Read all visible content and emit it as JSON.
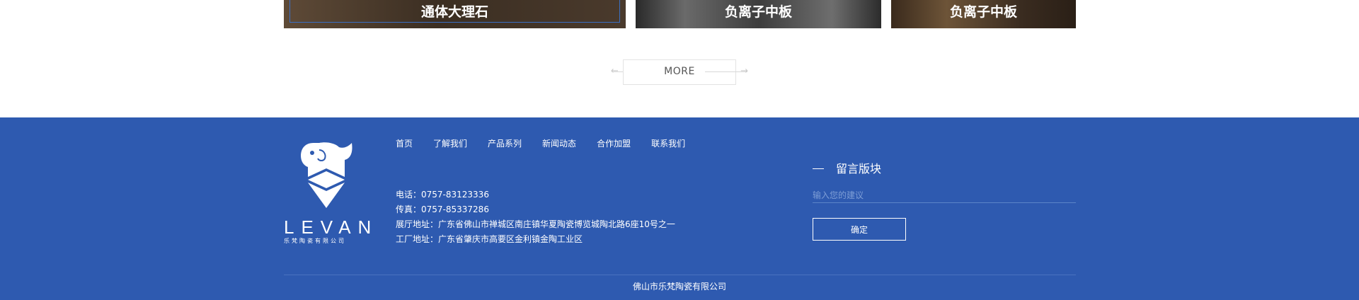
{
  "products": [
    {
      "label": "通体大理石"
    },
    {
      "label": "负离子中板"
    },
    {
      "label": "负离子中板"
    }
  ],
  "more": {
    "label": "MORE",
    "left_icon": "arrow-left-icon",
    "right_icon": "arrow-right-icon"
  },
  "footer": {
    "logo": {
      "brand": "LEVAN",
      "sub": "乐梵陶瓷有限公司",
      "icon": "elephant-logo-icon"
    },
    "nav": [
      "首页",
      "了解我们",
      "产品系列",
      "新闻动态",
      "合作加盟",
      "联系我们"
    ],
    "contact": {
      "phone": "电话：0757-83123336",
      "fax": "传真：0757-85337286",
      "showroom": "展厅地址：广东省佛山市禅城区南庄镇华夏陶瓷博览城陶北路6座10号之一",
      "factory": "工厂地址：广东省肇庆市高要区金利镇金陶工业区"
    },
    "message": {
      "title": "留言版块",
      "placeholder": "输入您的建议",
      "submit": "确定"
    },
    "copyright": "佛山市乐梵陶瓷有限公司"
  },
  "colors": {
    "footer_bg": "#2e5ab0",
    "text": "#ffffff"
  }
}
